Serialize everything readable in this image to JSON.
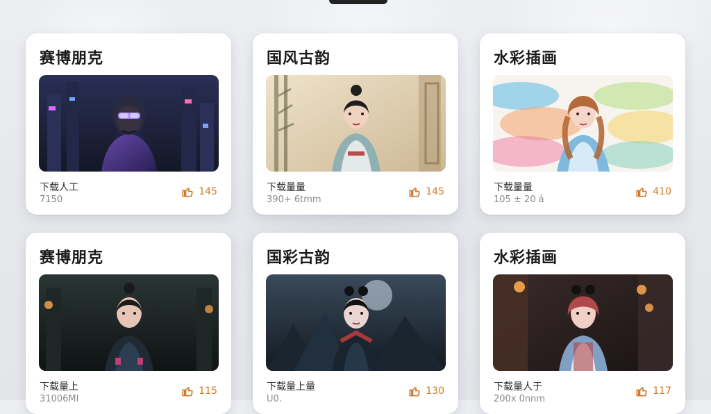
{
  "top_title_fragment": "",
  "cards": [
    {
      "title": "赛博朋克",
      "meta_label": "下载人工",
      "meta_sub": "7150",
      "likes": "145",
      "icon": "thumbs-up-icon",
      "theme": {
        "bg1": "#1a1f3a",
        "bg2": "#3a2a5a",
        "accent": "#9a6cff"
      }
    },
    {
      "title": "国风古韵",
      "meta_label": "下载量量",
      "meta_sub": "390+ 6tmm",
      "likes": "145",
      "icon": "thumbs-up-icon",
      "theme": {
        "bg1": "#e8dcc3",
        "bg2": "#c9b48f",
        "accent": "#7aa0a6"
      }
    },
    {
      "title": "水彩插画",
      "meta_label": "下载量量",
      "meta_sub": "105 ± 20 á",
      "likes": "410",
      "icon": "thumbs-up-icon",
      "theme": {
        "bg1": "#f5e6d6",
        "bg2": "#cfe3f5",
        "accent": "#7cc6e6"
      }
    },
    {
      "title": "赛博朋克",
      "meta_label": "下载量上",
      "meta_sub": "31006MI",
      "likes": "115",
      "icon": "thumbs-up-icon",
      "theme": {
        "bg1": "#1f2a2a",
        "bg2": "#3d4a4a",
        "accent": "#d07a2a"
      }
    },
    {
      "title": "国彩古韵",
      "meta_label": "下载量上量",
      "meta_sub": "U0.",
      "likes": "130",
      "icon": "thumbs-up-icon",
      "theme": {
        "bg1": "#1a2430",
        "bg2": "#3a4a5a",
        "accent": "#b03a3a"
      }
    },
    {
      "title": "水彩插画",
      "meta_label": "下载量人于",
      "meta_sub": "200x 0nnm",
      "likes": "117",
      "icon": "thumbs-up-icon",
      "theme": {
        "bg1": "#2a1a1a",
        "bg2": "#5a3a2a",
        "accent": "#f0a24a"
      }
    }
  ]
}
